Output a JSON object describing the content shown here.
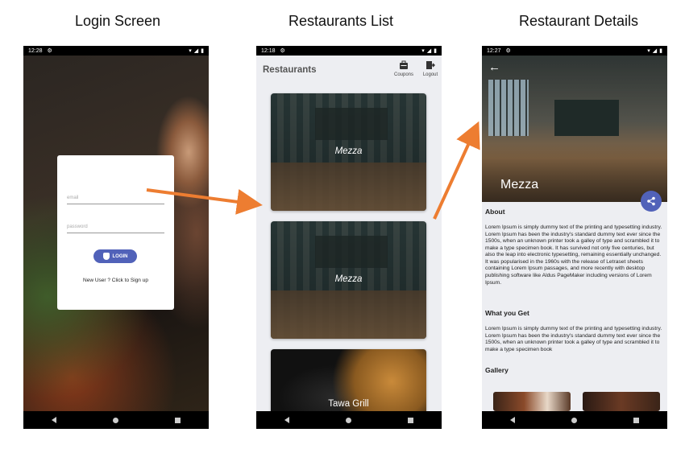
{
  "captions": {
    "login": "Login Screen",
    "list": "Restaurants List",
    "details": "Restaurant Details"
  },
  "login_screen": {
    "time": "12:28",
    "email_placeholder": "email",
    "password_placeholder": "password",
    "login_label": "LOGIN",
    "signup_text": "New User ? Click to Sign up"
  },
  "list_screen": {
    "time": "12:18",
    "title": "Restaurants",
    "actions": [
      {
        "label": "Coupons",
        "icon": "coupon-icon"
      },
      {
        "label": "Logout",
        "icon": "logout-icon"
      }
    ],
    "restaurants": [
      "Mezza",
      "Mezza",
      "Tawa Grill"
    ]
  },
  "details_screen": {
    "time": "12:27",
    "name": "Mezza",
    "about_heading": "About",
    "about_text": "Lorem Ipsum is simply dummy text of the printing and typesetting industry. Lorem Ipsum has been the industry's standard dummy text ever since the 1500s, when an unknown printer took a galley of type and scrambled it to make a type specimen book. It has survived not only five centuries, but also the leap into electronic typesetting, remaining essentially unchanged. It was popularised in the 1960s with the release of Letraset sheets containing Lorem Ipsum passages, and more recently with desktop publishing software like Aldus PageMaker including versions of Lorem Ipsum.",
    "what_heading": "What you Get",
    "what_text": "Lorem Ipsum is simply dummy text of the printing and typesetting industry. Lorem Ipsum has been the industry's standard dummy text ever since the 1500s, when an unknown printer took a galley of type and scrambled it to make a type specimen book",
    "gallery_heading": "Gallery"
  },
  "colors": {
    "accent": "#5162b9",
    "arrow": "#ed7d31",
    "screen_bg": "#edeef2"
  }
}
